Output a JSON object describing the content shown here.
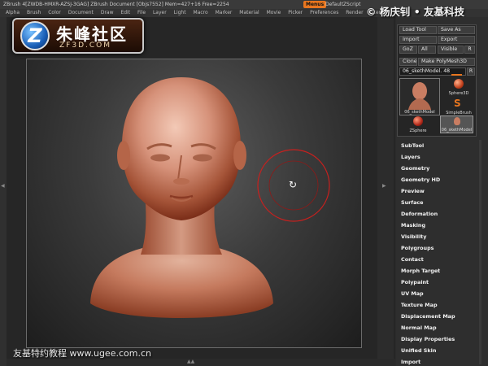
{
  "titlebar": {
    "text": "ZBrush 4[ZWDB-HMXR-AZSJ-3GAG]   ZBrush Document   [Objs7552] Mem=427+16 Free=2254",
    "menus_button": "Menus",
    "script": "DefaultZScript"
  },
  "menubar": {
    "items": [
      "Alpha",
      "Brush",
      "Color",
      "Document",
      "Draw",
      "Edit",
      "File",
      "Layer",
      "Light",
      "Macro",
      "Marker",
      "Material",
      "Movie",
      "Picker",
      "Preferences",
      "Render",
      "Stencil",
      "Stroke"
    ]
  },
  "watermark_top": "© 杨庆钊 • 友基科技",
  "logo": {
    "mark": "Z",
    "cn": "朱峰社区",
    "en": "ZF3D.COM"
  },
  "watermark_bottom": "友基特约教程  www.ugee.com.cn",
  "tool_panel": {
    "load_tool": "Load Tool",
    "save_as": "Save As",
    "import": "Import",
    "export": "Export",
    "goz": "GoZ",
    "all": "All",
    "visible": "Visible",
    "r": "R",
    "clone": "Clone",
    "make_polymesh": "Make PolyMesh3D",
    "model_name": "06_skethModel. 48",
    "model_slider": 0.48,
    "thumbs": {
      "main": "06_skethModel",
      "sphere3d": "Sphere3D",
      "simplebrush": "SimpleBrush",
      "zsphere": "ZSphere",
      "selected": "06_skethModel"
    }
  },
  "panel_menu": [
    "SubTool",
    "Layers",
    "Geometry",
    "Geometry HD",
    "Preview",
    "Surface",
    "Deformation",
    "Masking",
    "Visibility",
    "Polygroups",
    "Contact",
    "Morph Target",
    "Polypaint",
    "UV Map",
    "Texture Map",
    "Displacement Map",
    "Normal Map",
    "Display Properties",
    "Unified Skin",
    "Import"
  ],
  "colors": {
    "accent": "#e8761f",
    "brush_ring": "#c8201e",
    "sculpt": "#c97d62"
  }
}
